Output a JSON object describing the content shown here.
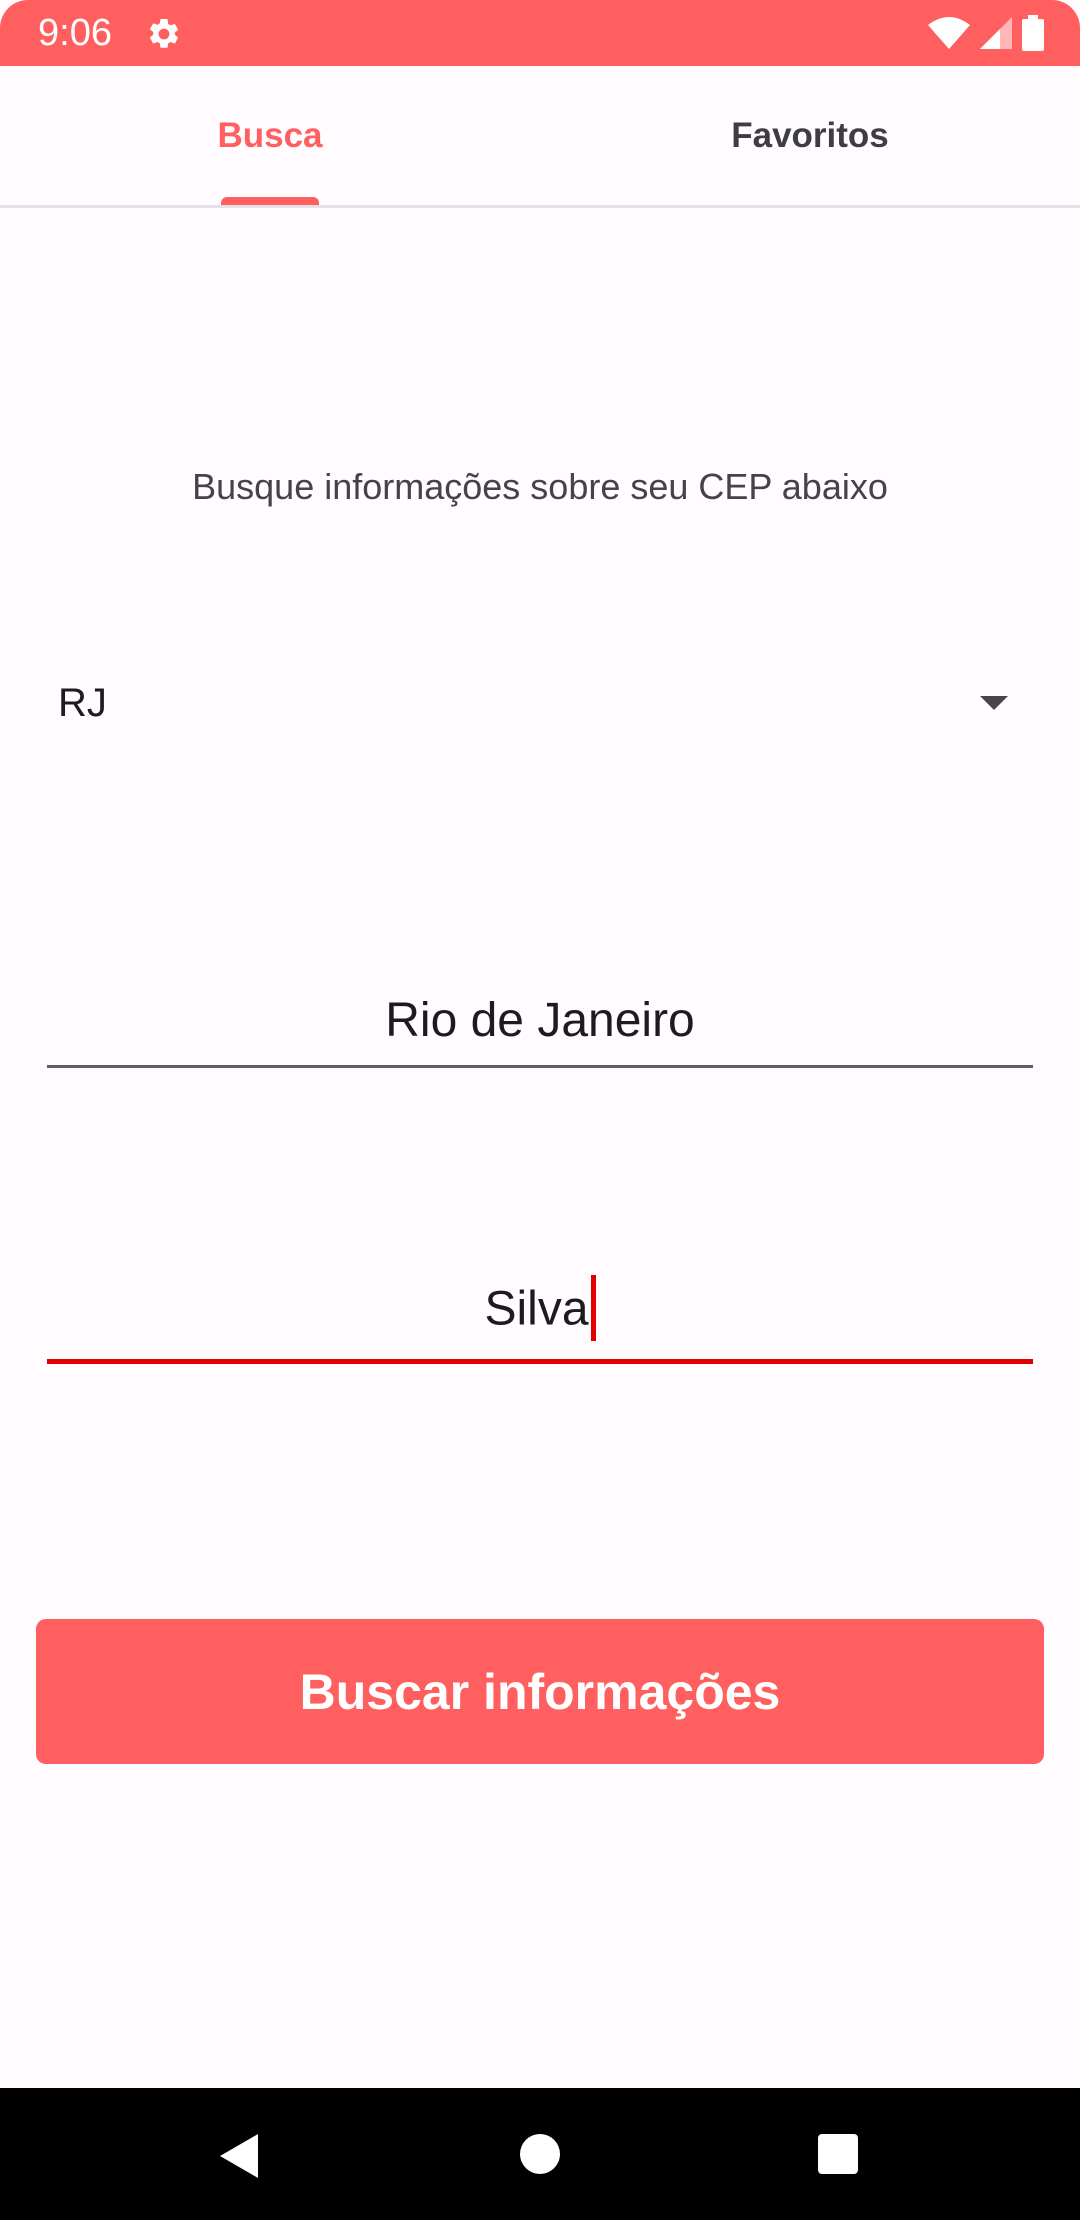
{
  "status_bar": {
    "time": "9:06",
    "icons": [
      "gear-icon",
      "wifi-icon",
      "signal-icon",
      "battery-icon"
    ],
    "color": "#FF5F5F"
  },
  "tabs": [
    {
      "label": "Busca",
      "selected": true
    },
    {
      "label": "Favoritos",
      "selected": false
    }
  ],
  "main": {
    "subtitle": "Busque informações sobre seu CEP abaixo",
    "state_spinner": {
      "selected": "RJ"
    },
    "city_input": {
      "value": "Rio de Janeiro"
    },
    "street_input": {
      "value": "Silva",
      "focused": true
    },
    "search_button": {
      "label": "Buscar informações"
    }
  },
  "nav_bar": {
    "icons": [
      "back-icon",
      "home-icon",
      "recents-icon"
    ]
  },
  "colors": {
    "accent": "#FF5F5F",
    "focus_underline": "#E10000",
    "background": "#FFFBFE"
  }
}
